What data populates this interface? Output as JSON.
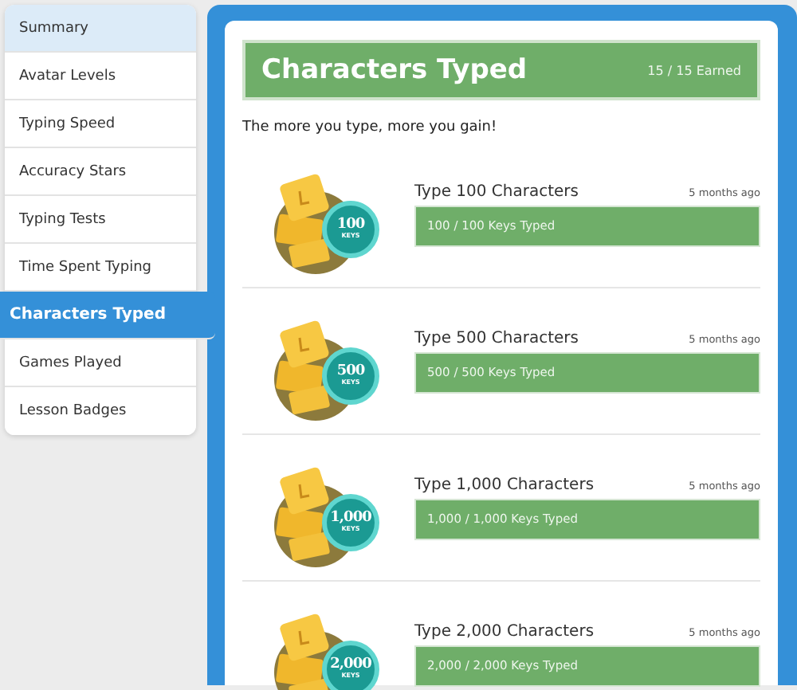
{
  "sidebar": {
    "items": [
      {
        "label": "Summary",
        "selected": false,
        "kind": "summary"
      },
      {
        "label": "Avatar Levels",
        "selected": false,
        "kind": "item"
      },
      {
        "label": "Typing Speed",
        "selected": false,
        "kind": "item"
      },
      {
        "label": "Accuracy Stars",
        "selected": false,
        "kind": "item"
      },
      {
        "label": "Typing Tests",
        "selected": false,
        "kind": "item"
      },
      {
        "label": "Time Spent Typing",
        "selected": false,
        "kind": "item"
      },
      {
        "label": "Characters Typed",
        "selected": true,
        "kind": "item"
      },
      {
        "label": "Games Played",
        "selected": false,
        "kind": "item"
      },
      {
        "label": "Lesson Badges",
        "selected": false,
        "kind": "item"
      }
    ]
  },
  "header": {
    "title": "Characters Typed",
    "earned": "15 / 15 Earned"
  },
  "tagline": "The more you type, more you gain!",
  "achievements": [
    {
      "title": "Type 100 Characters",
      "time": "5 months ago",
      "progress": "100 / 100 Keys Typed",
      "level": 1,
      "badge_number": "100",
      "badge_unit": "KEYS"
    },
    {
      "title": "Type 500 Characters",
      "time": "5 months ago",
      "progress": "500 / 500 Keys Typed",
      "level": 1,
      "badge_number": "500",
      "badge_unit": "KEYS"
    },
    {
      "title": "Type 1,000 Characters",
      "time": "5 months ago",
      "progress": "1,000 / 1,000 Keys Typed",
      "level": 1,
      "badge_number": "1,000",
      "badge_unit": "KEYS"
    },
    {
      "title": "Type 2,000 Characters",
      "time": "5 months ago",
      "progress": "2,000 / 2,000 Keys Typed",
      "level": 1,
      "badge_number": "2,000",
      "badge_unit": "KEYS"
    }
  ]
}
